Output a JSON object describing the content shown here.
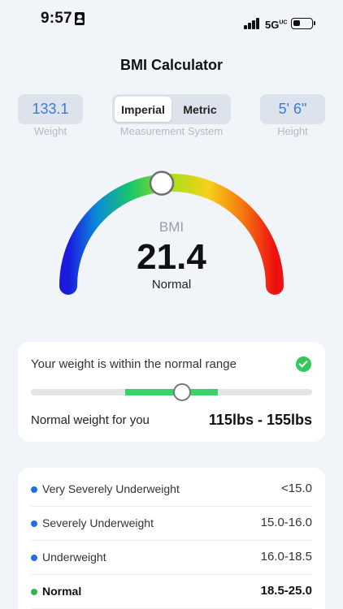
{
  "status_bar": {
    "time": "9:57",
    "network": "5G",
    "network_suffix": "UC"
  },
  "title": "BMI Calculator",
  "inputs": {
    "weight_value": "133.1",
    "weight_label": "Weight",
    "height_value": "5' 6\"",
    "height_label": "Height",
    "system_label": "Measurement System",
    "systems": [
      "Imperial",
      "Metric"
    ],
    "selected_system": "Imperial"
  },
  "gauge": {
    "caption": "BMI",
    "value": "21.4",
    "category": "Normal",
    "position_fraction": 0.47
  },
  "range_card": {
    "status_text": "Your weight is within the normal range",
    "normal_label": "Normal weight for you",
    "normal_range": "115lbs - 155lbs",
    "fill_start_fraction": 0.335,
    "fill_end_fraction": 0.665,
    "thumb_fraction": 0.538
  },
  "categories": [
    {
      "name": "Very Severely Underweight",
      "range": "<15.0",
      "color": "#1f6fe0",
      "active": false
    },
    {
      "name": "Severely Underweight",
      "range": "15.0-16.0",
      "color": "#1f6fe0",
      "active": false
    },
    {
      "name": "Underweight",
      "range": "16.0-18.5",
      "color": "#1f6fe0",
      "active": false
    },
    {
      "name": "Normal",
      "range": "18.5-25.0",
      "color": "#2fb84f",
      "active": true
    }
  ],
  "colors": {
    "accent": "#3a7bd5",
    "success": "#34c759"
  }
}
